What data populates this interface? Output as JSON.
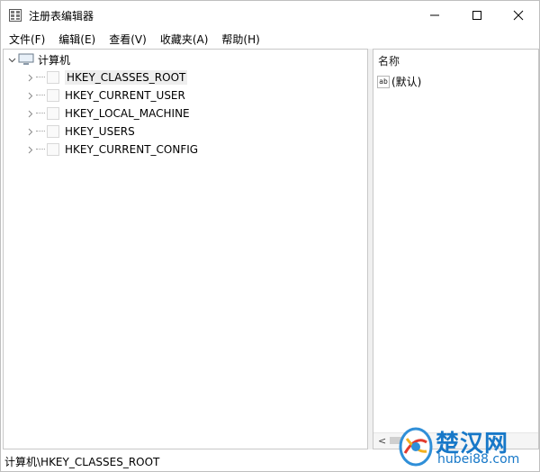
{
  "window": {
    "title": "注册表编辑器"
  },
  "menu": {
    "items": [
      {
        "label": "文件(F)"
      },
      {
        "label": "编辑(E)"
      },
      {
        "label": "查看(V)"
      },
      {
        "label": "收藏夹(A)"
      },
      {
        "label": "帮助(H)"
      }
    ]
  },
  "tree": {
    "root_label": "计算机",
    "hives": [
      {
        "label": "HKEY_CLASSES_ROOT",
        "selected": true
      },
      {
        "label": "HKEY_CURRENT_USER"
      },
      {
        "label": "HKEY_LOCAL_MACHINE"
      },
      {
        "label": "HKEY_USERS"
      },
      {
        "label": "HKEY_CURRENT_CONFIG"
      }
    ]
  },
  "list": {
    "column_name": "名称",
    "values": [
      {
        "icon": "string-value-icon",
        "icon_text": "ab",
        "name": "(默认)"
      }
    ]
  },
  "status": {
    "path": "计算机\\HKEY_CLASSES_ROOT"
  },
  "watermark": {
    "name": "楚汉网",
    "domain": "hubei88.com"
  },
  "colors": {
    "watermark_blue": "#1778c8",
    "selection_gray": "#eeeeee"
  }
}
